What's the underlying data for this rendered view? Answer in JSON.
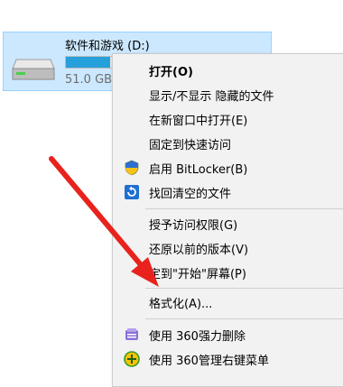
{
  "drive": {
    "name": "软件和游戏 (D:)",
    "size_text": "51.0 GB",
    "usage_fraction": 0.9,
    "bar_color": "#26a0da",
    "tile_bg": "#cce8ff"
  },
  "context_menu": {
    "items": [
      {
        "label": "打开(O)",
        "bold": true
      },
      {
        "label": "显示/不显示 隐藏的文件"
      },
      {
        "label": "在新窗口中打开(E)"
      },
      {
        "label": "固定到快速访问"
      },
      {
        "label": "启用 BitLocker(B)",
        "icon": "shield-icon"
      },
      {
        "label": "找回清空的文件",
        "icon": "recover-icon"
      },
      {
        "label": "授予访问权限(G)"
      },
      {
        "label": "还原以前的版本(V)"
      },
      {
        "label": "定到\"开始\"屏幕(P)"
      },
      {
        "label": "格式化(A)..."
      },
      {
        "label": "使用 360强力删除",
        "icon": "360-delete-icon"
      },
      {
        "label": "使用 360管理右键菜单",
        "icon": "360-menu-icon"
      }
    ]
  },
  "annotation": {
    "arrow_color": "#e8221c"
  }
}
